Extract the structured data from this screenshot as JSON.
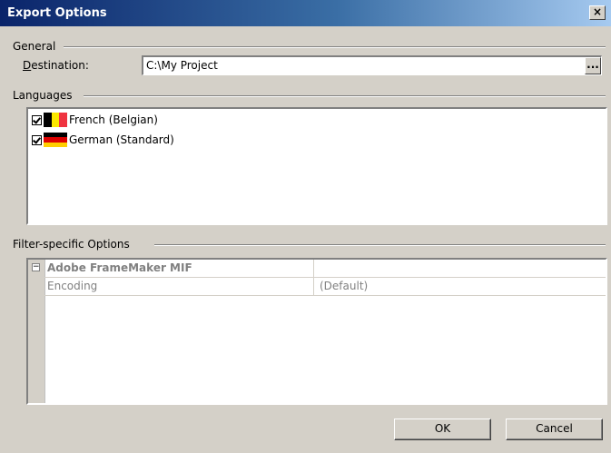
{
  "window": {
    "title": "Export Options",
    "close_label": "×"
  },
  "general": {
    "group_label": "General",
    "destination_label": "Destination:",
    "destination_value": "C:\\My Project",
    "browse_label": "..."
  },
  "languages": {
    "group_label": "Languages",
    "items": [
      {
        "label": "French (Belgian)",
        "checked": true,
        "flag": "belgium-flag-icon"
      },
      {
        "label": "German (Standard)",
        "checked": true,
        "flag": "germany-flag-icon"
      }
    ]
  },
  "filter": {
    "group_label": "Filter-specific Options",
    "expand_glyph": "−",
    "category": "Adobe FrameMaker MIF",
    "rows": [
      {
        "name": "Encoding",
        "value": "(Default)"
      }
    ]
  },
  "buttons": {
    "ok": "OK",
    "cancel": "Cancel"
  },
  "colors": {
    "title_bar_start": "#0a246a",
    "title_bar_end": "#a6caf0",
    "dialog_face": "#d4d0c8",
    "disabled_text": "#808080"
  }
}
